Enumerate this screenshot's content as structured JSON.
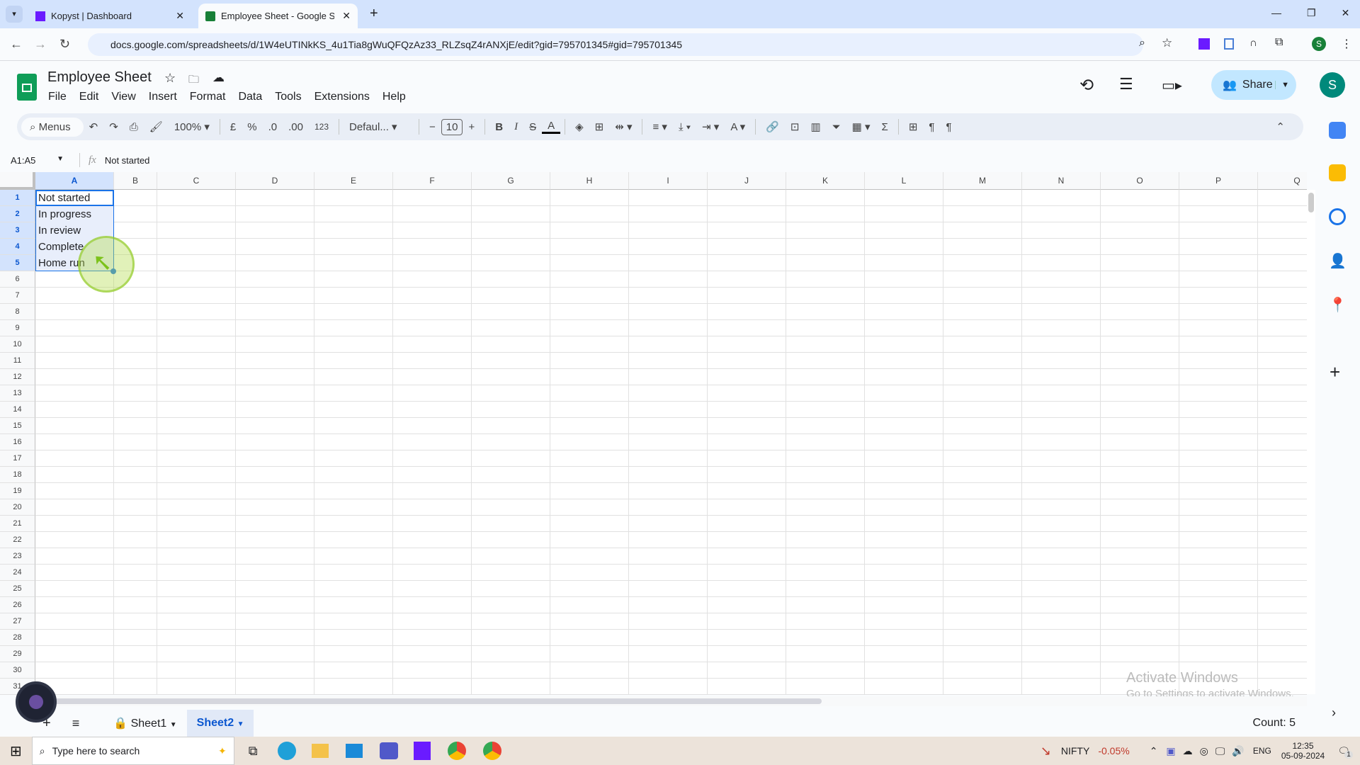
{
  "browser": {
    "tabs": [
      {
        "title": "Kopyst | Dashboard",
        "active": false
      },
      {
        "title": "Employee Sheet - Google Sheets",
        "active": true
      }
    ],
    "url": "docs.google.com/spreadsheets/d/1W4eUTINkKS_4u1Tia8gWuQFQzAz33_RLZsqZ4rANXjE/edit?gid=795701345#gid=795701345",
    "profile_initial": "S"
  },
  "doc": {
    "title": "Employee Sheet",
    "menus": [
      "File",
      "Edit",
      "View",
      "Insert",
      "Format",
      "Data",
      "Tools",
      "Extensions",
      "Help"
    ],
    "share_label": "Share",
    "avatar": "S"
  },
  "toolbar": {
    "search": "Menus",
    "zoom": "100%",
    "currency": "£",
    "percent": "%",
    "dec_minus": ".0",
    "dec_plus": ".00",
    "number_format": "123",
    "font": "Defaul...",
    "font_size": "10",
    "bold": "B",
    "italic": "I"
  },
  "formula_bar": {
    "name_box": "A1:A5",
    "fx": "fx",
    "value": "Not started"
  },
  "grid": {
    "columns": [
      "A",
      "B",
      "C",
      "D",
      "E",
      "F",
      "G",
      "H",
      "I",
      "J",
      "K",
      "L",
      "M",
      "N",
      "O",
      "P",
      "Q"
    ],
    "rows": [
      "1",
      "2",
      "3",
      "4",
      "5",
      "6",
      "7",
      "8",
      "9",
      "10",
      "11",
      "12",
      "13",
      "14",
      "15",
      "16",
      "17",
      "18",
      "19",
      "20",
      "21",
      "22",
      "23",
      "24",
      "25",
      "26",
      "27",
      "28",
      "29",
      "30",
      "31"
    ],
    "cells_A": [
      "Not started",
      "In progress",
      "In review",
      "Complete",
      "Home run"
    ],
    "accent": "#1a73e8"
  },
  "sheets": {
    "tabs": [
      "Sheet1",
      "Sheet2"
    ],
    "active": "Sheet2",
    "status": "Count: 5"
  },
  "watermark": {
    "title": "Activate Windows",
    "subtitle": "Go to Settings to activate Windows."
  },
  "taskbar": {
    "search_placeholder": "Type here to search",
    "ticker": "NIFTY",
    "ticker_change": "-0.05%",
    "lang": "ENG",
    "time": "12:35",
    "date": "05-09-2024",
    "notifications": "1"
  }
}
